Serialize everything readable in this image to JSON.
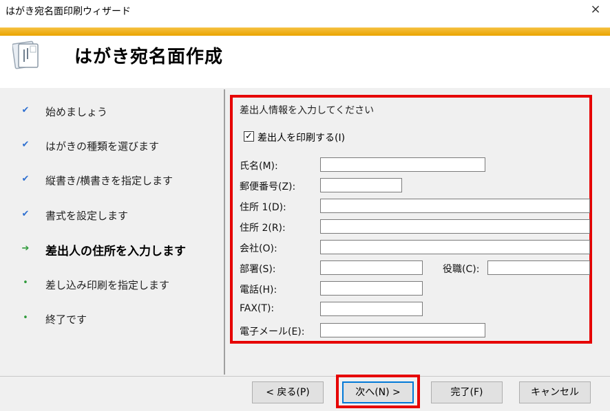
{
  "window": {
    "title": "はがき宛名面印刷ウィザード",
    "close_icon": "×"
  },
  "header": {
    "title": "はがき宛名面作成",
    "icon": "wizard-postcard-icon"
  },
  "steps": [
    {
      "label": "始めましょう",
      "state": "done",
      "mark": "✔"
    },
    {
      "label": "はがきの種類を選びます",
      "state": "done",
      "mark": "✔"
    },
    {
      "label": "縦書き/横書きを指定します",
      "state": "done",
      "mark": "✔"
    },
    {
      "label": "書式を設定します",
      "state": "done",
      "mark": "✔"
    },
    {
      "label": "差出人の住所を入力します",
      "state": "current",
      "mark": "➔"
    },
    {
      "label": "差し込み印刷を指定します",
      "state": "pending",
      "mark": "•"
    },
    {
      "label": "終了です",
      "state": "pending",
      "mark": "•"
    }
  ],
  "form": {
    "section_title": "差出人情報を入力してください",
    "print_sender": {
      "label": "差出人を印刷する(I)",
      "checked": true,
      "mark": "✓"
    },
    "fields": {
      "name": {
        "label": "氏名(M):",
        "value": ""
      },
      "postal": {
        "label": "郵便番号(Z):",
        "value": ""
      },
      "address1": {
        "label": "住所 1(D):",
        "value": ""
      },
      "address2": {
        "label": "住所 2(R):",
        "value": ""
      },
      "company": {
        "label": "会社(O):",
        "value": ""
      },
      "department": {
        "label": "部署(S):",
        "value": ""
      },
      "title": {
        "label": "役職(C):",
        "value": ""
      },
      "phone": {
        "label": "電話(H):",
        "value": ""
      },
      "fax": {
        "label": "FAX(T):",
        "value": ""
      },
      "email": {
        "label": "電子メール(E):",
        "value": ""
      }
    }
  },
  "buttons": {
    "back": "< 戻る(P)",
    "next": "次へ(N) >",
    "finish": "完了(F)",
    "cancel": "キャンセル"
  },
  "colors": {
    "accent_bar": "#f0b323",
    "highlight": "#e60000",
    "check_done": "#2e6fd0",
    "arrow_current": "#2e9a3a",
    "dot_pending": "#2e9a3a"
  }
}
